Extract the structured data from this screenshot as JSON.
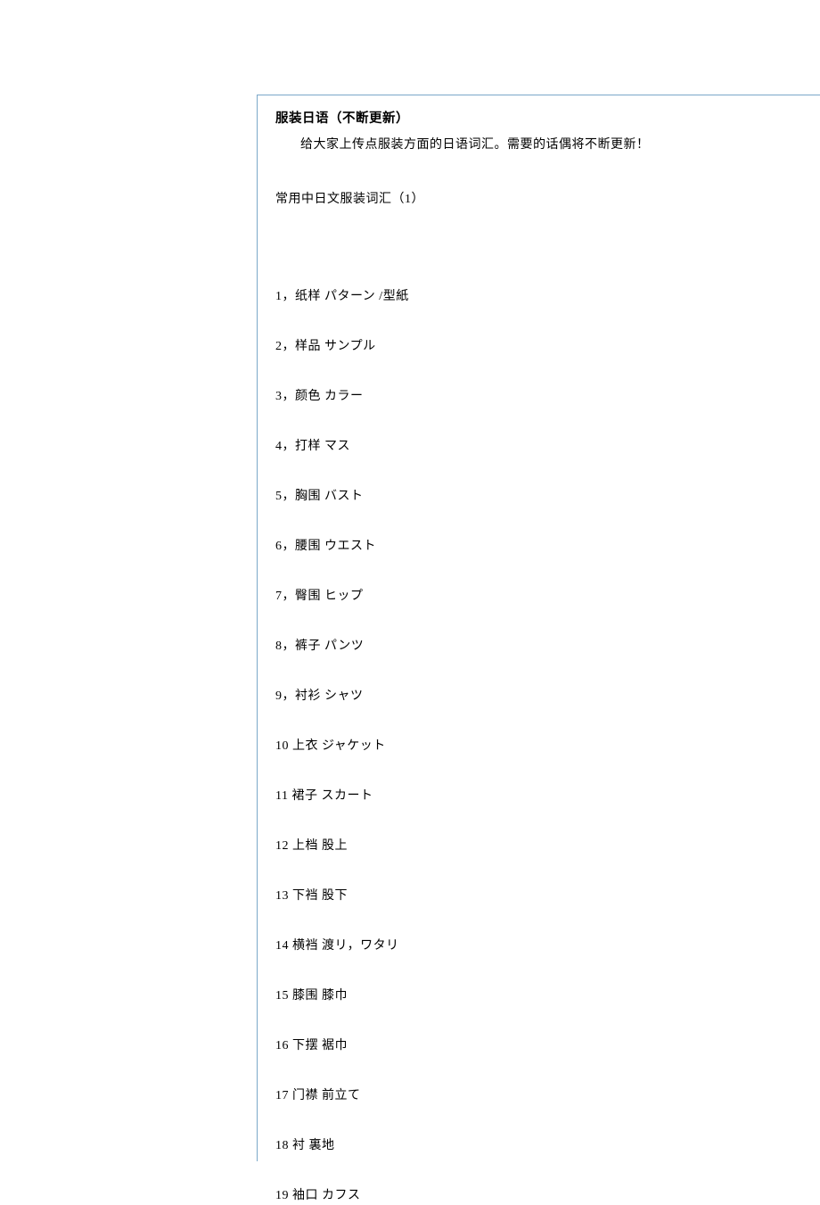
{
  "title": "服装日语（不断更新）",
  "intro": "给大家上传点服装方面的日语词汇。需要的话偶将不断更新！",
  "subtitle": "常用中日文服装词汇（1）",
  "items": [
    "1，纸样  パターン  /型紙",
    "2，样品  サンプル",
    "3，颜色  カラー",
    "4，打样  マス",
    "5，胸围  バスト",
    "6，腰围  ウエスト",
    "7，臀围  ヒップ",
    "8，裤子  パンツ",
    "9，衬衫  シャツ",
    "10 上衣  ジャケット",
    "11 裙子  スカート",
    "12 上档  股上",
    "13 下裆  股下",
    "14 横裆  渡リ，ワタリ",
    "15 膝围  膝巾",
    "16 下摆  裾巾",
    "17 门襟  前立て",
    "18 衬      裏地",
    "19 袖口  カフス"
  ]
}
